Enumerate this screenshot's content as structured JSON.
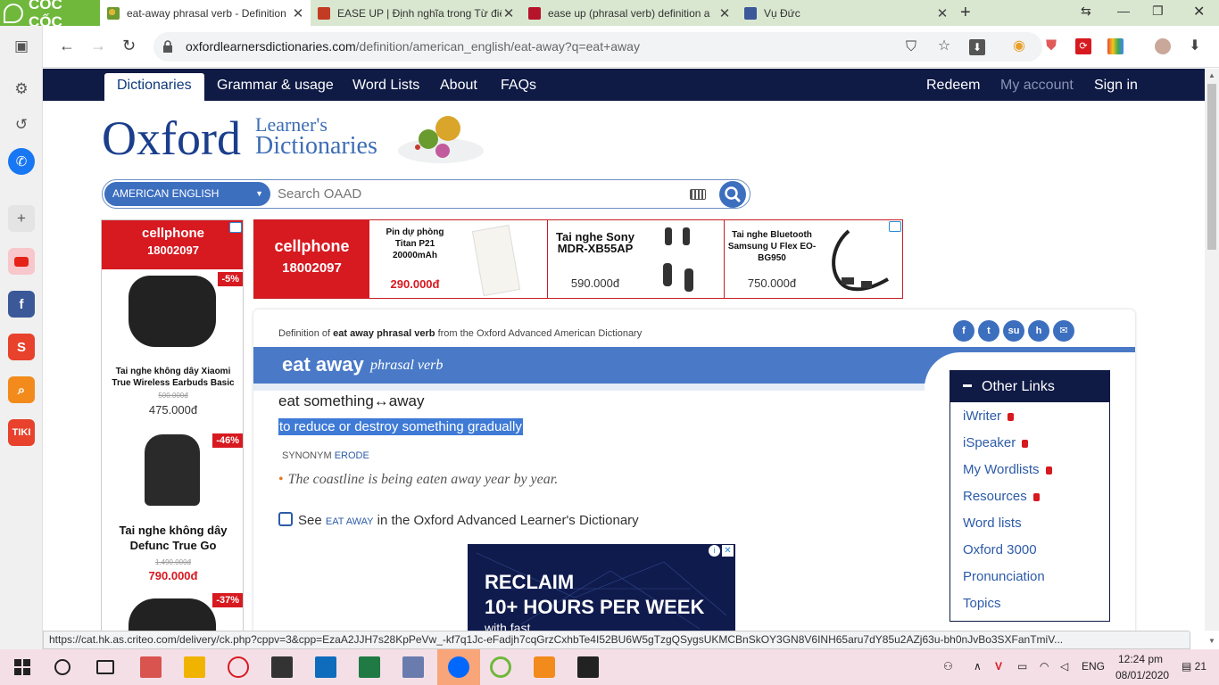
{
  "browser": {
    "brand": "CỐC CỐC",
    "tabs": [
      {
        "title": "eat-away phrasal verb - Definition",
        "active": true
      },
      {
        "title": "EASE UP | Định nghĩa trong Từ điể",
        "active": false
      },
      {
        "title": "ease up (phrasal verb) definition a",
        "active": false
      },
      {
        "title": "Vụ Đức",
        "active": false
      }
    ],
    "url_domain": "oxfordlearnersdictionaries.com",
    "url_path": "/definition/american_english/eat-away?q=eat+away",
    "status_url": "https://cat.hk.as.criteo.com/delivery/ck.php?cppv=3&cpp=EzaA2JJH7s28KpPeVw_-kf7q1Jc-eFadjh7cqGrzCxhbTe4I52BU6W5gTzgQSygsUKMCBnSkOY3GN8V6INH65aru7dY85u2AZj63u-bh0nJvBo3SXFanTmiV..."
  },
  "site": {
    "nav": {
      "dictionaries": "Dictionaries",
      "grammar": "Grammar & usage",
      "word_lists": "Word Lists",
      "about": "About",
      "faqs": "FAQs",
      "redeem": "Redeem",
      "my_account": "My account",
      "sign_in": "Sign in"
    },
    "logo": {
      "oxford": "Oxford",
      "learners": "Learner's",
      "dictionaries": "Dictionaries"
    },
    "search": {
      "lang": "AMERICAN ENGLISH",
      "placeholder": "Search OAAD"
    }
  },
  "ads": {
    "brand": "cellphone",
    "phone": "18002097",
    "left": [
      {
        "name": "Tai nghe không dây Xiaomi True Wireless Earbuds Basic",
        "old_price": "500.000đ",
        "price": "475.000đ",
        "discount": "-5%"
      },
      {
        "name": "Tai nghe không dây Defunc True Go",
        "old_price": "1.490.000đ",
        "price": "790.000đ",
        "discount": "-46%"
      },
      {
        "discount": "-37%"
      }
    ],
    "top": [
      {
        "name": "Pin dự phòng Titan P21 20000mAh",
        "price": "290.000đ"
      },
      {
        "name": "Tai nghe Sony MDR-XB55AP",
        "price": "590.000đ"
      },
      {
        "name": "Tai nghe Bluetooth Samsung U Flex EO-BG950",
        "price": "750.000đ"
      }
    ]
  },
  "entry": {
    "definition_of_prefix": "Definition of",
    "definition_of_word": "eat away phrasal verb",
    "definition_of_suffix": "from the Oxford Advanced American Dictionary",
    "headword": "eat away",
    "pos": "phrasal verb",
    "verb_pattern": "eat something↔away",
    "sense": "to reduce or destroy something gradually",
    "synonym_label": "SYNONYM",
    "synonym_word": "ERODE",
    "example": "The coastline is being eaten away year by year.",
    "see_prefix": "See",
    "see_link": "EAT AWAY",
    "see_suffix": "in the Oxford Advanced Learner's Dictionary"
  },
  "other_links": {
    "title": "Other Links",
    "items": [
      "iWriter",
      "iSpeaker",
      "My Wordlists",
      "Resources",
      "Word lists",
      "Oxford 3000",
      "Pronunciation",
      "Topics"
    ]
  },
  "banner": {
    "line1": "RECLAIM",
    "line2": "10+ HOURS PER WEEK",
    "line3": "with fast"
  },
  "taskbar": {
    "lang": "ENG",
    "time": "12:24 pm",
    "date": "08/01/2020",
    "notif": "21"
  }
}
